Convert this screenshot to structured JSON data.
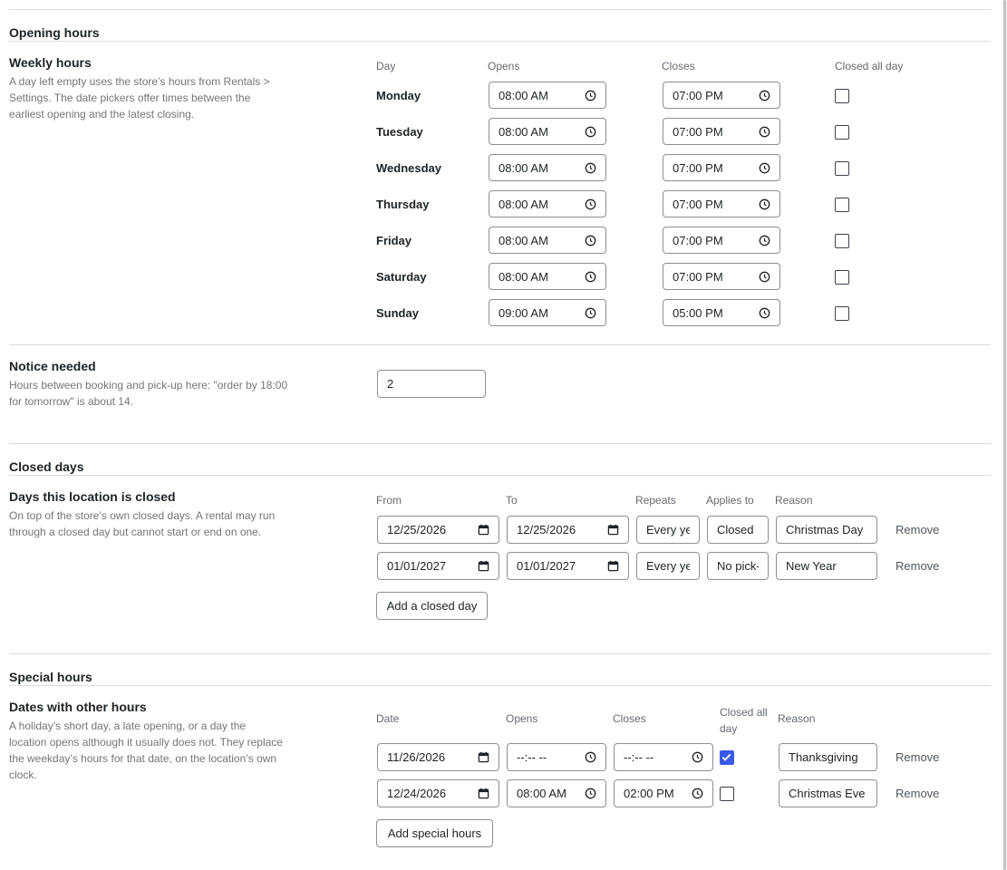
{
  "opening": {
    "section_title": "Opening hours",
    "weekly_title": "Weekly hours",
    "weekly_desc_lines": [
      "A day left empty uses the store’s hours from Rentals >",
      "Settings. The date pickers offer times between the",
      "earliest opening and the latest closing."
    ],
    "headers": {
      "day": "Day",
      "opens": "Opens",
      "closes": "Closes",
      "closed_all_day": "Closed all day"
    },
    "days": [
      {
        "day": "Monday",
        "opens": "08:00 AM",
        "closes": "07:00 PM",
        "closed": false
      },
      {
        "day": "Tuesday",
        "opens": "08:00 AM",
        "closes": "07:00 PM",
        "closed": false
      },
      {
        "day": "Wednesday",
        "opens": "08:00 AM",
        "closes": "07:00 PM",
        "closed": false
      },
      {
        "day": "Thursday",
        "opens": "08:00 AM",
        "closes": "07:00 PM",
        "closed": false
      },
      {
        "day": "Friday",
        "opens": "08:00 AM",
        "closes": "07:00 PM",
        "closed": false
      },
      {
        "day": "Saturday",
        "opens": "08:00 AM",
        "closes": "07:00 PM",
        "closed": false
      },
      {
        "day": "Sunday",
        "opens": "09:00 AM",
        "closes": "05:00 PM",
        "closed": false
      }
    ]
  },
  "notice": {
    "title": "Notice needed",
    "desc_lines": [
      "Hours between booking and pick-up here: \"order by 18:00",
      "for tomorrow\" is about 14."
    ],
    "value": "2"
  },
  "closed_days": {
    "section_title": "Closed days",
    "sub_title": "Days this location is closed",
    "desc_lines": [
      "On top of the store’s own closed days. A rental may run",
      "through a closed day but cannot start or end on one."
    ],
    "headers": {
      "from": "From",
      "to": "To",
      "repeats": "Repeats",
      "applies_to": "Applies to",
      "reason": "Reason"
    },
    "rows": [
      {
        "from": "12/25/2026",
        "to": "12/25/2026",
        "repeats": "Every year",
        "applies_to": "Closed",
        "reason": "Christmas Day",
        "remove": "Remove"
      },
      {
        "from": "01/01/2027",
        "to": "01/01/2027",
        "repeats": "Every year",
        "applies_to": "No pick-up",
        "reason": "New Year",
        "remove": "Remove"
      }
    ],
    "add_button": "Add a closed day"
  },
  "special": {
    "section_title": "Special hours",
    "sub_title": "Dates with other hours",
    "desc_lines": [
      "A holiday’s short day, a late opening, or a day the",
      "location opens although it usually does not. They replace",
      "the weekday’s hours for that date, on the location’s own",
      "clock."
    ],
    "headers": {
      "date": "Date",
      "opens": "Opens",
      "closes": "Closes",
      "closed_all_day_1": "Closed all",
      "closed_all_day_2": "day",
      "reason": "Reason"
    },
    "rows": [
      {
        "date": "11/26/2026",
        "opens": "--:-- --",
        "closes": "--:-- --",
        "closed": true,
        "reason": "Thanksgiving",
        "remove": "Remove"
      },
      {
        "date": "12/24/2026",
        "opens": "08:00 AM",
        "closes": "02:00 PM",
        "closed": false,
        "reason": "Christmas Eve",
        "remove": "Remove"
      }
    ],
    "add_button": "Add special hours"
  }
}
